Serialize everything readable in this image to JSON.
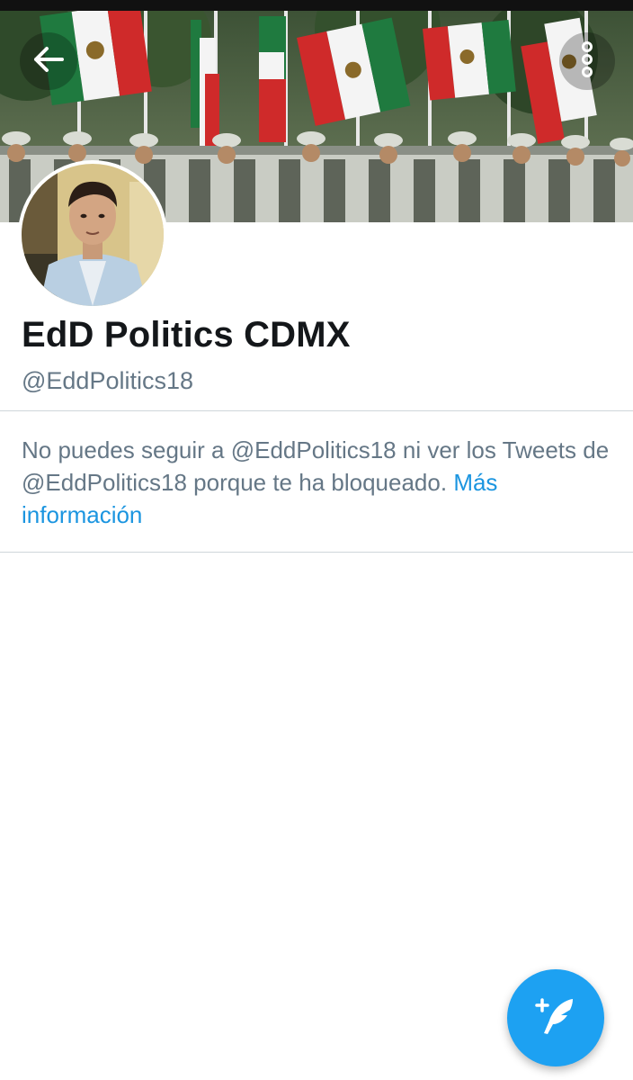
{
  "profile": {
    "display_name": "EdD Politics CDMX",
    "handle": "@EddPolitics18"
  },
  "blocked_notice": {
    "message": "No puedes seguir a @EddPolitics18 ni ver los Tweets de @EddPolitics18 porque te ha bloqueado.",
    "link_label": "Más información"
  },
  "icons": {
    "back": "arrow-left-icon",
    "more": "vertical-ellipsis-icon",
    "compose": "feather-plus-icon"
  },
  "colors": {
    "link": "#1b95e0",
    "fab": "#1da1f2",
    "name_text": "#14171a",
    "secondary_text": "#657786",
    "divider": "#cfd6db"
  }
}
